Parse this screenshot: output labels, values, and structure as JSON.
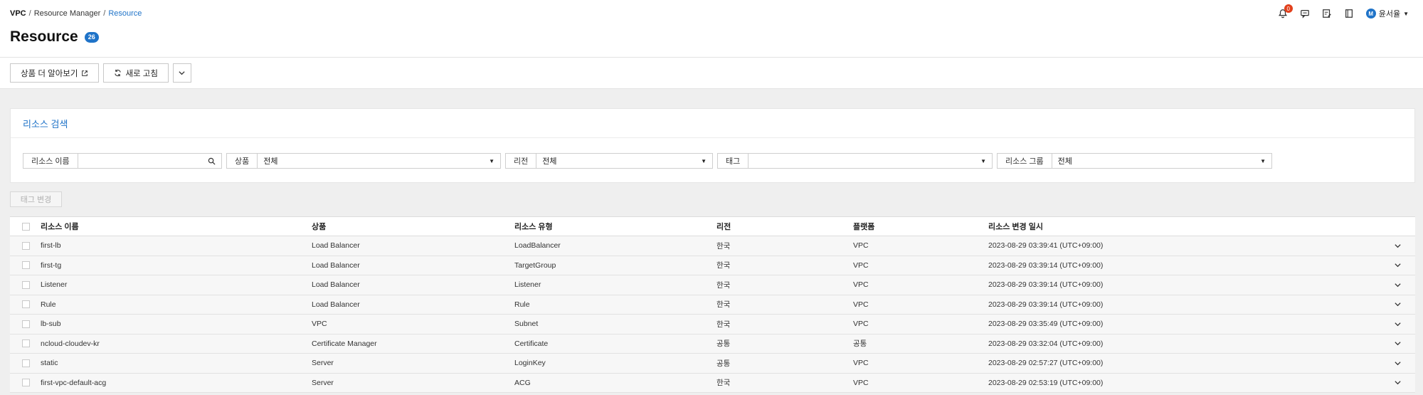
{
  "breadcrumb": [
    "VPC",
    "Resource Manager",
    "Resource"
  ],
  "page": {
    "title": "Resource",
    "count": "26"
  },
  "toolbar": {
    "learn_more": "상품 더 알아보기",
    "refresh": "새로 고침"
  },
  "header_util": {
    "notification_count": "0",
    "user_initial": "M",
    "user_name": "윤서율"
  },
  "search": {
    "title": "리소스 검색",
    "filters": [
      {
        "label": "리소스 이름",
        "value": ""
      },
      {
        "label": "상품",
        "value": "전체"
      },
      {
        "label": "리전",
        "value": "전체"
      },
      {
        "label": "태그",
        "value": ""
      },
      {
        "label": "리소스 그룹",
        "value": "전체"
      }
    ]
  },
  "tag_change": "태그 변경",
  "table": {
    "columns": [
      "리소스 이름",
      "상품",
      "리소스 유형",
      "리전",
      "플랫폼",
      "리소스 변경 일시"
    ],
    "rows": [
      [
        "first-lb",
        "Load Balancer",
        "LoadBalancer",
        "한국",
        "VPC",
        "2023-08-29 03:39:41 (UTC+09:00)"
      ],
      [
        "first-tg",
        "Load Balancer",
        "TargetGroup",
        "한국",
        "VPC",
        "2023-08-29 03:39:14 (UTC+09:00)"
      ],
      [
        "Listener",
        "Load Balancer",
        "Listener",
        "한국",
        "VPC",
        "2023-08-29 03:39:14 (UTC+09:00)"
      ],
      [
        "Rule",
        "Load Balancer",
        "Rule",
        "한국",
        "VPC",
        "2023-08-29 03:39:14 (UTC+09:00)"
      ],
      [
        "lb-sub",
        "VPC",
        "Subnet",
        "한국",
        "VPC",
        "2023-08-29 03:35:49 (UTC+09:00)"
      ],
      [
        "ncloud-cloudev-kr",
        "Certificate Manager",
        "Certificate",
        "공통",
        "공통",
        "2023-08-29 03:32:04 (UTC+09:00)"
      ],
      [
        "static",
        "Server",
        "LoginKey",
        "공통",
        "VPC",
        "2023-08-29 02:57:27 (UTC+09:00)"
      ],
      [
        "first-vpc-default-acg",
        "Server",
        "ACG",
        "한국",
        "VPC",
        "2023-08-29 02:53:19 (UTC+09:00)"
      ]
    ]
  },
  "colors": {
    "accent": "#1f73c8",
    "badge_red": "#e2401c",
    "row_bg": "#f7f7f7"
  }
}
